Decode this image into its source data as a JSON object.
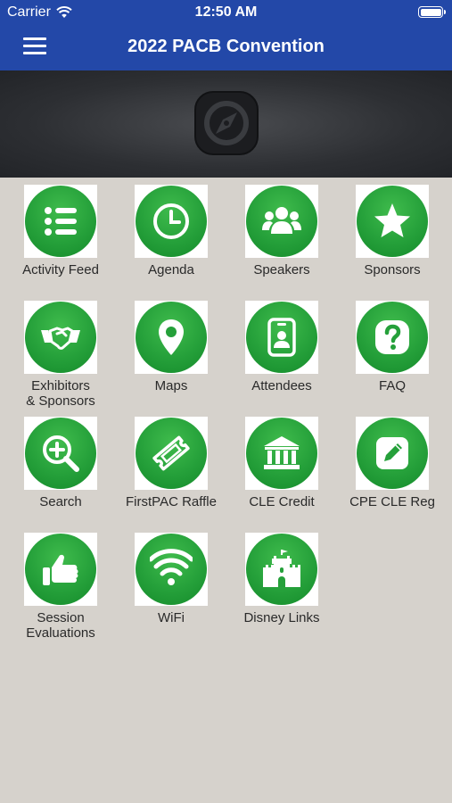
{
  "status_bar": {
    "carrier": "Carrier",
    "time": "12:50 AM"
  },
  "header": {
    "title": "2022 PACB Convention"
  },
  "colors": {
    "header_bg": "#2348a8",
    "icon_green": "#25a03a",
    "page_bg": "#d6d2cc"
  },
  "tiles": [
    {
      "label": "Activity Feed",
      "icon": "list-icon"
    },
    {
      "label": "Agenda",
      "icon": "clock-icon"
    },
    {
      "label": "Speakers",
      "icon": "group-icon"
    },
    {
      "label": "Sponsors",
      "icon": "star-icon"
    },
    {
      "label": "Exhibitors\n& Sponsors",
      "icon": "handshake-icon"
    },
    {
      "label": "Maps",
      "icon": "map-pin-icon"
    },
    {
      "label": "Attendees",
      "icon": "badge-icon"
    },
    {
      "label": "FAQ",
      "icon": "question-icon"
    },
    {
      "label": "Search",
      "icon": "zoom-in-icon"
    },
    {
      "label": "FirstPAC Raffle",
      "icon": "ticket-icon"
    },
    {
      "label": "CLE Credit",
      "icon": "bank-icon"
    },
    {
      "label": "CPE CLE Reg",
      "icon": "edit-icon"
    },
    {
      "label": "Session\nEvaluations",
      "icon": "thumbs-up-icon"
    },
    {
      "label": "WiFi",
      "icon": "wifi-icon"
    },
    {
      "label": "Disney Links",
      "icon": "castle-icon"
    }
  ]
}
